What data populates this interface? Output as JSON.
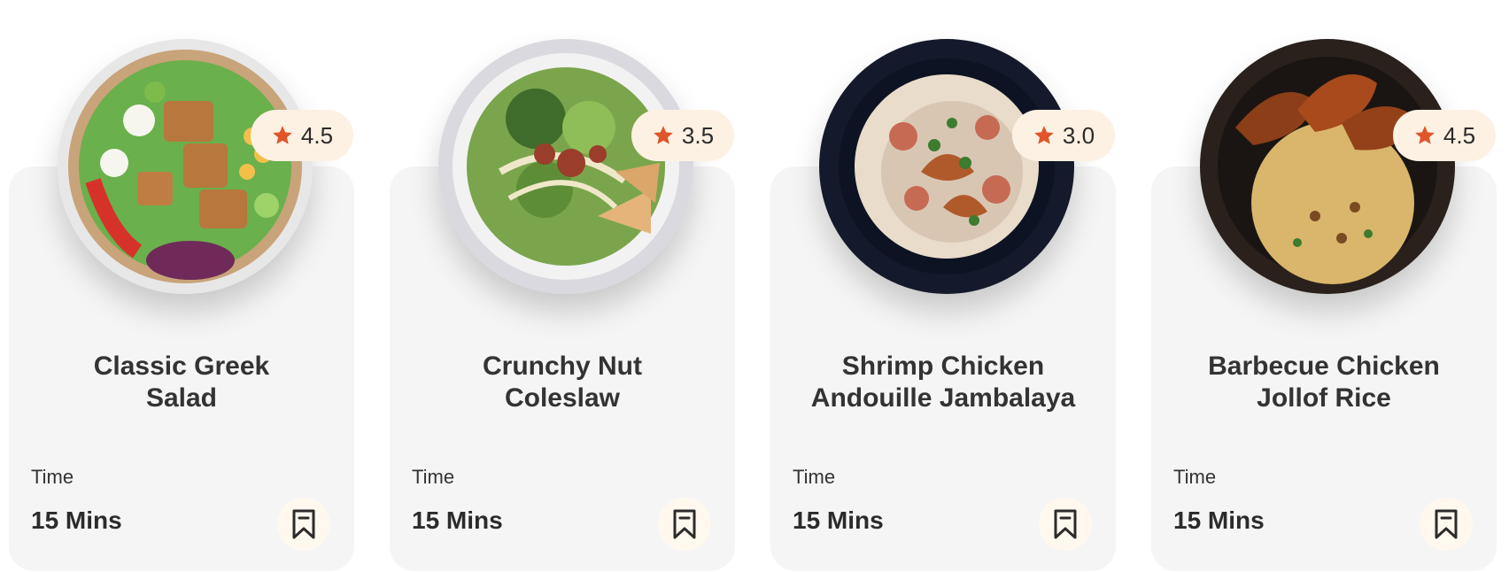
{
  "accent_color": "#e0562a",
  "cards": [
    {
      "title_line1": "Classic Greek",
      "title_line2": "Salad",
      "rating": "4.5",
      "time_label": "Time",
      "time_value": "15 Mins",
      "bookmark_icon": "bookmark-icon",
      "star_icon": "star-icon"
    },
    {
      "title_line1": "Crunchy Nut",
      "title_line2": "Coleslaw",
      "rating": "3.5",
      "time_label": "Time",
      "time_value": "15 Mins",
      "bookmark_icon": "bookmark-icon",
      "star_icon": "star-icon"
    },
    {
      "title_line1": "Shrimp Chicken",
      "title_line2": "Andouille Jambalaya",
      "rating": "3.0",
      "time_label": "Time",
      "time_value": "15 Mins",
      "bookmark_icon": "bookmark-icon",
      "star_icon": "star-icon"
    },
    {
      "title_line1": "Barbecue Chicken",
      "title_line2": "Jollof Rice",
      "rating": "4.5",
      "time_label": "Time",
      "time_value": "15 Mins",
      "bookmark_icon": "bookmark-icon",
      "star_icon": "star-icon"
    }
  ]
}
